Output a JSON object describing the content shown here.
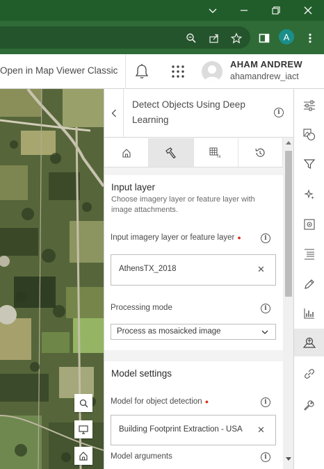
{
  "header": {
    "open_classic": "Open in Map Viewer Classic",
    "user_name": "AHAM ANDREW",
    "user_handle": "ahamandrew_iact",
    "profile_initial": "A"
  },
  "panel": {
    "title": "Detect Objects Using Deep Learning",
    "input_section": {
      "heading": "Input layer",
      "description": "Choose imagery layer or feature layer with image attachments.",
      "layer_label": "Input imagery layer or feature layer",
      "layer_value": "AthensTX_2018",
      "mode_label": "Processing mode",
      "mode_value": "Process as mosaicked image"
    },
    "model_section": {
      "heading": "Model settings",
      "model_label": "Model for object detection",
      "model_value": "Building Footprint Extraction - USA",
      "args_label": "Model arguments"
    }
  },
  "colors": {
    "title_bar": "#215d2a",
    "url_bar": "#2f6b37",
    "required_marker": "#d83020",
    "profile_badge": "#1a8f8a"
  }
}
